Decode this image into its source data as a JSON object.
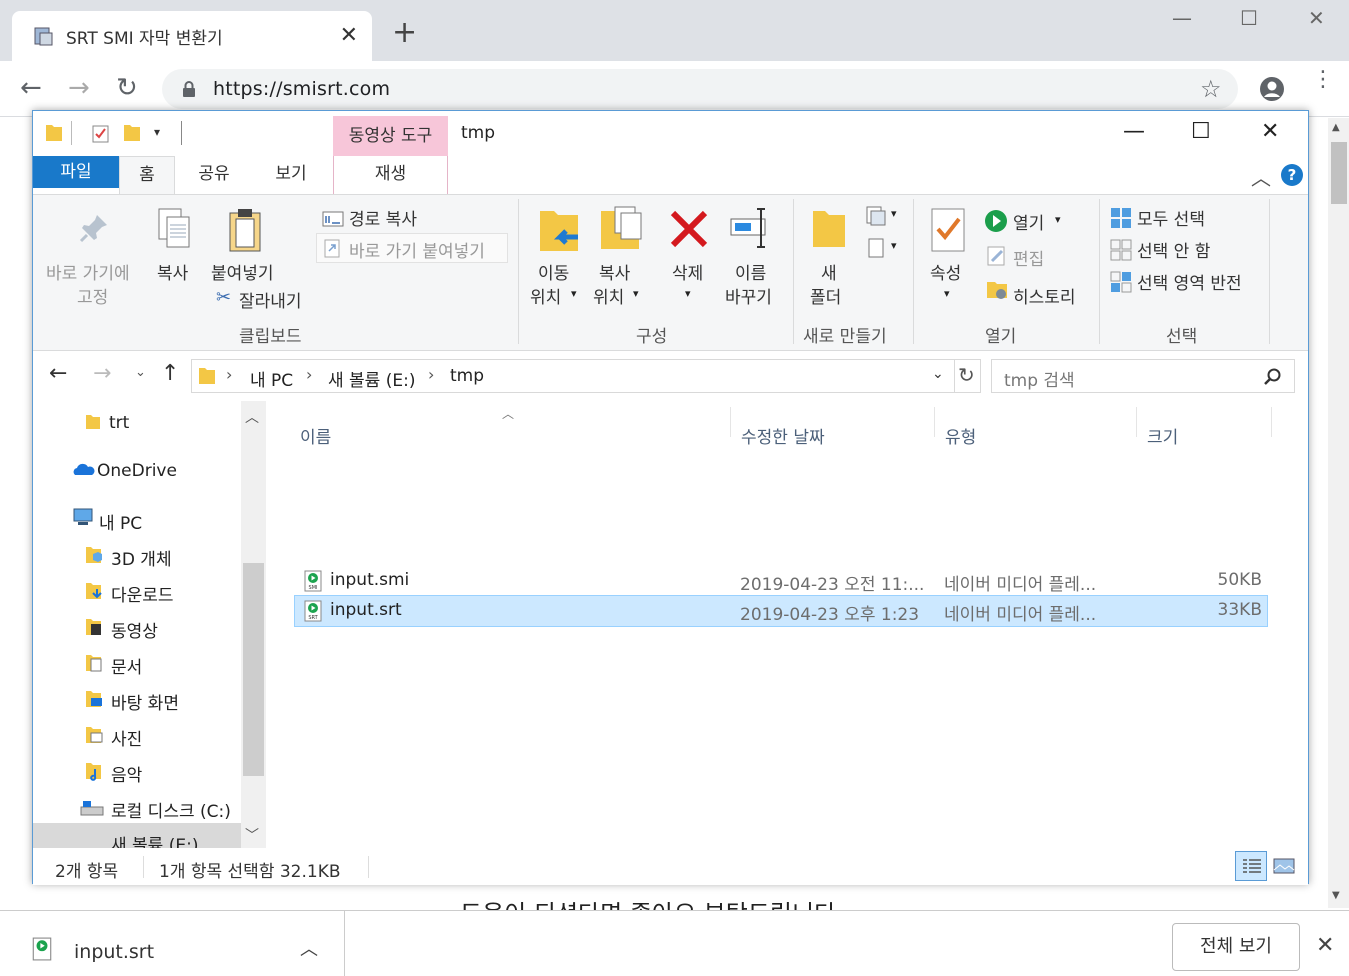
{
  "browser": {
    "tab_title": "SRT SMI 자막 변환기",
    "url": "https://smisrt.com"
  },
  "page": {
    "partial_text": "도움이 되셨다면 좋아요 부탁드립니다"
  },
  "explorer": {
    "context_tab": "동영상 도구",
    "title": "tmp",
    "ribbon_tabs": [
      "파일",
      "홈",
      "공유",
      "보기",
      "재생"
    ],
    "clipboard": {
      "pin_line1": "바로 가기에",
      "pin_line2": "고정",
      "copy": "복사",
      "paste": "붙여넣기",
      "copy_path": "경로 복사",
      "paste_shortcut": "바로 가기 붙여넣기",
      "cut": "잘라내기",
      "group": "클립보드"
    },
    "organize": {
      "move_line1": "이동",
      "move_line2": "위치",
      "copyto_line1": "복사",
      "copyto_line2": "위치",
      "delete": "삭제",
      "rename_line1": "이름",
      "rename_line2": "바꾸기",
      "group": "구성"
    },
    "new": {
      "folder_line1": "새",
      "folder_line2": "폴더",
      "group": "새로 만들기"
    },
    "open": {
      "properties": "속성",
      "open": "열기",
      "edit": "편집",
      "history": "히스토리",
      "group": "열기"
    },
    "select": {
      "all": "모두 선택",
      "none": "선택 안 함",
      "invert": "선택 영역 반전",
      "group": "선택"
    },
    "breadcrumb": [
      "내 PC",
      "새 볼륨 (E:)",
      "tmp"
    ],
    "search_placeholder": "tmp 검색",
    "nav": [
      "trt",
      "OneDrive",
      "내 PC",
      "3D 개체",
      "다운로드",
      "동영상",
      "문서",
      "바탕 화면",
      "사진",
      "음악",
      "로컬 디스크 (C:)",
      "새 볼륨 (E:)"
    ],
    "columns": [
      "이름",
      "수정한 날짜",
      "유형",
      "크기"
    ],
    "files": [
      {
        "name": "input.smi",
        "date": "2019-04-23 오전 11:...",
        "type": "네이버 미디어 플레...",
        "size": "50KB",
        "badge": "SMI"
      },
      {
        "name": "input.srt",
        "date": "2019-04-23 오후 1:23",
        "type": "네이버 미디어 플레...",
        "size": "33KB",
        "badge": "SRT"
      }
    ],
    "status_count": "2개 항목",
    "status_selected": "1개 항목 선택함 32.1KB"
  },
  "downloads": {
    "file": "input.srt",
    "show_all": "전체 보기"
  },
  "colors": {
    "accent": "#1979ca",
    "selection": "#cce8ff",
    "context_tab": "#f7c6d9",
    "delete_red": "#d4191e"
  }
}
